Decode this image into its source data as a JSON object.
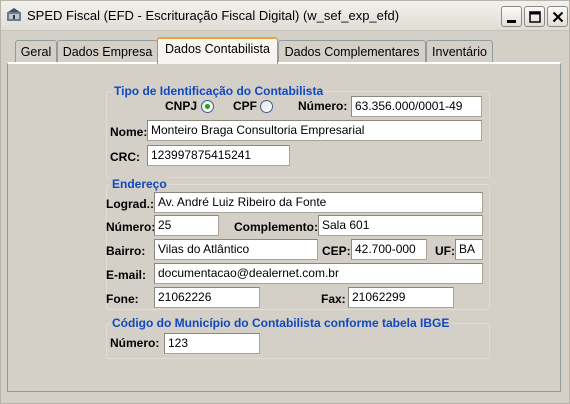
{
  "window": {
    "title": "SPED Fiscal (EFD - Escrituração Fiscal Digital) (w_sef_exp_efd)"
  },
  "tabs": [
    {
      "label": "Geral"
    },
    {
      "label": "Dados Empresa"
    },
    {
      "label": "Dados Contabilista"
    },
    {
      "label": "Dados Complementares"
    },
    {
      "label": "Inventário"
    }
  ],
  "active_tab": "Dados Contabilista",
  "identificacao": {
    "title": "Tipo de Identificação do Contabilista",
    "cnpj_label": "CNPJ",
    "cpf_label": "CPF",
    "selected": "CNPJ",
    "numero_label": "Número:",
    "numero_value": "63.356.000/0001-49",
    "nome_label": "Nome:",
    "nome_value": "Monteiro Braga Consultoria Empresarial",
    "crc_label": "CRC:",
    "crc_value": "123997875415241"
  },
  "endereco": {
    "title": "Endereço",
    "lograd_label": "Lograd.:",
    "lograd_value": "Av. André Luiz Ribeiro da Fonte",
    "numero_label": "Número:",
    "numero_value": "25",
    "complemento_label": "Complemento:",
    "complemento_value": "Sala 601",
    "bairro_label": "Bairro:",
    "bairro_value": "Vilas do Atlântico",
    "cep_label": "CEP:",
    "cep_value": "42.700-000",
    "uf_label": "UF:",
    "uf_value": "BA",
    "email_label": "E-mail:",
    "email_value": "documentacao@dealernet.com.br",
    "fone_label": "Fone:",
    "fone_value": "21062226",
    "fax_label": "Fax:",
    "fax_value": "21062299"
  },
  "municipio": {
    "title": "Código do Município do Contabilista conforme tabela IBGE",
    "numero_label": "Número:",
    "numero_value": "123"
  },
  "colors": {
    "group_title": "#1048c0",
    "active_tab_accent": "#e8a33c",
    "radio_selected": "#21a121"
  },
  "icons": {
    "app": "sped-app-icon",
    "minimize": "minimize-icon",
    "maximize": "maximize-icon",
    "close": "close-icon"
  }
}
